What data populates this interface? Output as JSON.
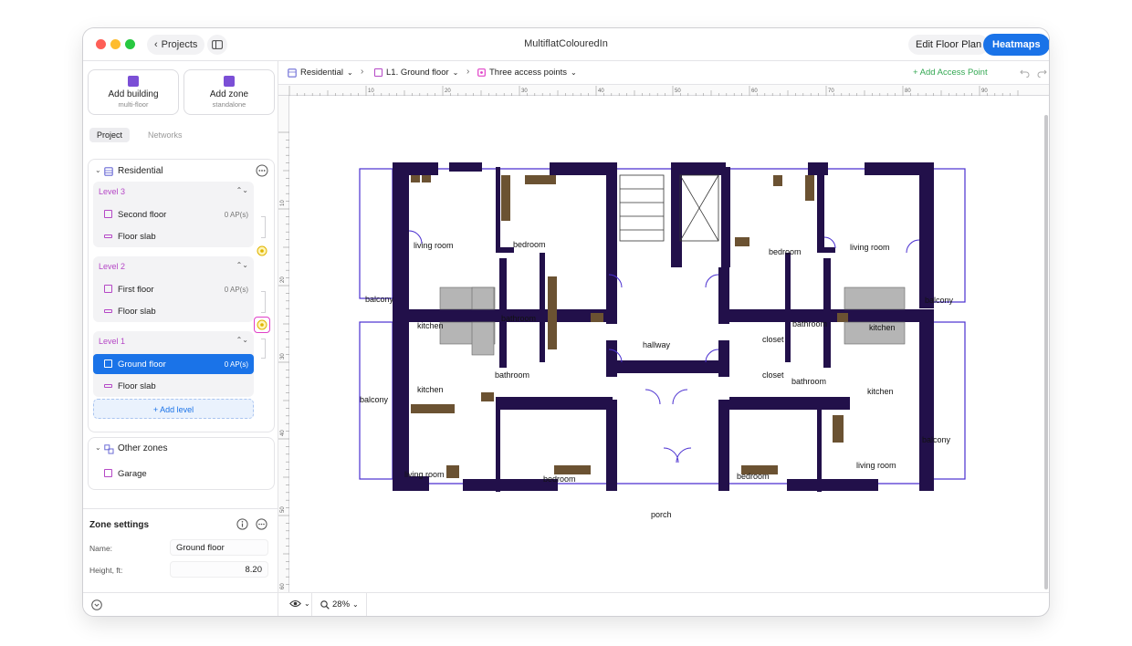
{
  "window": {
    "title": "MultiflatColouredIn",
    "projects_label": "Projects",
    "edit_floor_plan": "Edit Floor Plan",
    "heatmaps": "Heatmaps"
  },
  "sidebar": {
    "add_building": {
      "label": "Add building",
      "sub": "multi-floor"
    },
    "add_zone": {
      "label": "Add zone",
      "sub": "standalone"
    },
    "tabs": [
      "Project",
      "Networks"
    ],
    "residential": {
      "name": "Residential",
      "levels": [
        {
          "title": "Level 3",
          "items": [
            {
              "label": "Second floor",
              "ap": "0 AP(s)"
            },
            {
              "label": "Floor slab",
              "ap": ""
            }
          ]
        },
        {
          "title": "Level 2",
          "items": [
            {
              "label": "First floor",
              "ap": "0 AP(s)"
            },
            {
              "label": "Floor slab",
              "ap": ""
            }
          ]
        },
        {
          "title": "Level 1",
          "items": [
            {
              "label": "Ground floor",
              "ap": "0 AP(s)"
            },
            {
              "label": "Floor slab",
              "ap": ""
            }
          ]
        }
      ],
      "add_level": "+ Add level"
    },
    "other_zones": {
      "name": "Other zones",
      "items": [
        {
          "label": "Garage"
        }
      ]
    },
    "zone_settings": {
      "title": "Zone settings",
      "name_label": "Name:",
      "name_value": "Ground floor",
      "height_label": "Height, ft:",
      "height_value": "8.20"
    }
  },
  "breadcrumb": {
    "building": "Residential",
    "floor": "L1. Ground floor",
    "scenario": "Three access points",
    "add_access_point": "+ Add Access Point"
  },
  "ruler": {
    "top": [
      "10",
      "20",
      "30",
      "40",
      "50",
      "60",
      "70",
      "80",
      "90"
    ],
    "left": [
      "10",
      "20",
      "30",
      "40",
      "50",
      "60"
    ]
  },
  "floorplan": {
    "rooms": [
      "living room",
      "bedroom",
      "bedroom",
      "living room",
      "balcony",
      "balcony",
      "bathroom",
      "kitchen",
      "hallway",
      "bathroom",
      "kitchen",
      "closet",
      "closet",
      "bathroom",
      "bathroom",
      "balcony",
      "kitchen",
      "kitchen",
      "balcony",
      "living room",
      "bedroom",
      "bedroom",
      "living room",
      "porch"
    ]
  },
  "bottom": {
    "zoom": "28%"
  }
}
